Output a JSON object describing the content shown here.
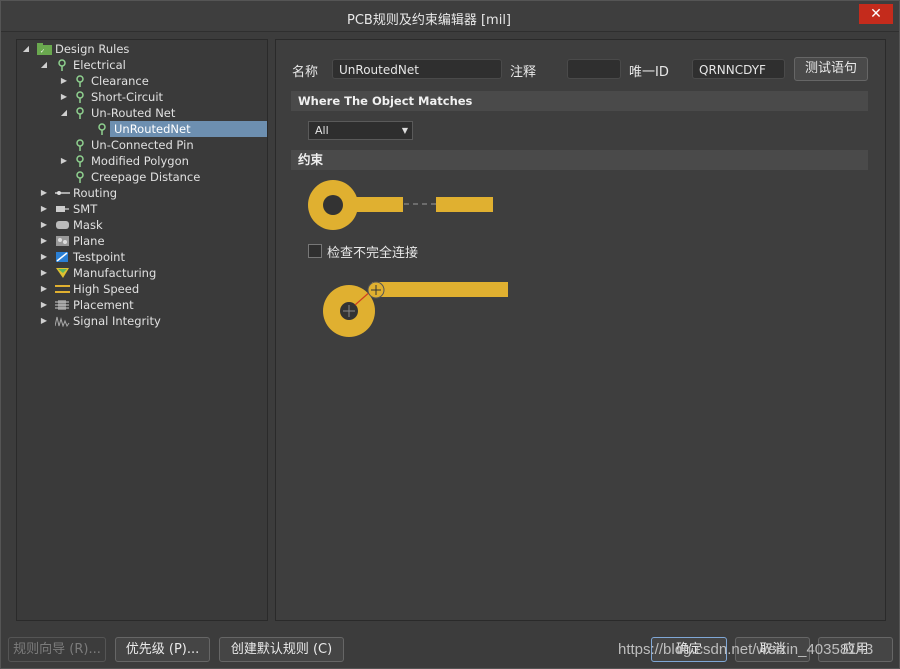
{
  "window": {
    "title": "PCB规则及约束编辑器 [mil]",
    "close_glyph": "✕"
  },
  "tree": {
    "root": "Design Rules",
    "electrical": "Electrical",
    "clearance": "Clearance",
    "short_circuit": "Short-Circuit",
    "un_routed_net": "Un-Routed Net",
    "unroutednet_rule": "UnRoutedNet",
    "un_connected_pin": "Un-Connected Pin",
    "modified_polygon": "Modified Polygon",
    "creepage_distance": "Creepage Distance",
    "routing": "Routing",
    "smt": "SMT",
    "mask": "Mask",
    "plane": "Plane",
    "testpoint": "Testpoint",
    "manufacturing": "Manufacturing",
    "high_speed": "High Speed",
    "placement": "Placement",
    "signal_integrity": "Signal Integrity"
  },
  "rule": {
    "name_label": "名称",
    "name_value": "UnRoutedNet",
    "comment_label": "注释",
    "comment_value": "",
    "uid_label": "唯一ID",
    "uid_value": "QRNNCDYF",
    "test_button": "测试语句"
  },
  "match": {
    "heading": "Where The Object Matches",
    "selected": "All"
  },
  "constraints": {
    "heading": "约束",
    "checkbox_label": "检查不完全连接",
    "checked": false
  },
  "footer": {
    "rule_wizard": "规则向导 (R)...",
    "priorities": "优先级 (P)...",
    "create_default": "创建默认规则 (C)",
    "ok": "确定",
    "cancel": "取消",
    "apply": "应用",
    "watermark": "https://blog.csdn.net/weixin_40358143"
  },
  "colors": {
    "pad": "#e0b030",
    "hole": "#333333",
    "accent": "#c42b1c"
  }
}
